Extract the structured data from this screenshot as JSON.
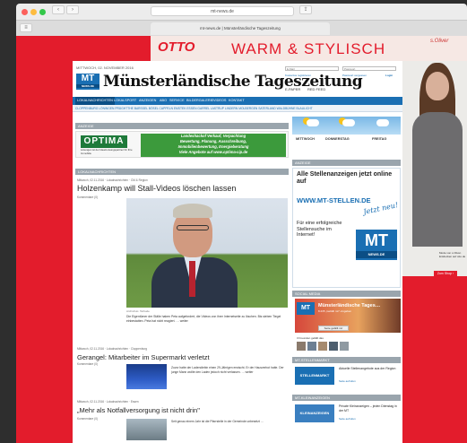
{
  "browser": {
    "url": "mt-news.de",
    "tab_title": "mt-news.de | Münsterländische Tageszeitung"
  },
  "ad_banner": {
    "brand": "OTTO",
    "headline": "WARM & STYLISCH",
    "partner": "s.Oliver"
  },
  "side_ad": {
    "caption": "Mode von s.Oliver. Entdecken auf otto.de",
    "cta": "Zum Shop ›"
  },
  "site": {
    "date": "MITTWOCH, 02. NOVEMBER 2016",
    "logo_top": "MT",
    "logo_bottom": "NEWS.DE",
    "masthead": "Münsterländische Tageszeitung",
    "login": {
      "email_label": "E-Mail",
      "password_label": "Passwort",
      "register": "Kostenlos registrieren",
      "forgot": "Passwort vergessen",
      "submit": "Login"
    },
    "epaper": "E-PAPER",
    "redfeed": "RED FEED",
    "nav_main": [
      "LOKALNACHRICHTEN",
      "LOKALSPORT",
      "ANZEIGEN",
      "ABO",
      "SERVICE",
      "BILDERGALERIE",
      "VIDEOS",
      "KONTAKT"
    ],
    "nav_sub": "CLOPPENBURG  LÖNINGEN  PRÜGHTTHE  BARSSEL  BÖSEL  CAPPELN  EMSTEK  ESSEN  GARREL  LASTRUP  LINDERN  MOLBERGEN  SATERLAND  WALDBÜHNE  BLAULICHT"
  },
  "left": {
    "ad_section": "ANZEIGE",
    "optima": {
      "logo": "OPTIMA",
      "sub": "Lösungen ist der Ideal-Lösungspartner für Ihre Immobilie",
      "lines": [
        "Landeshackof Verkauf, Verpachtung",
        "Bewertung, Planung, Ausschreibung,",
        "Immobilienbewertung, Energieberatung",
        "Viele Angebote auf www.optima-cip.de"
      ]
    },
    "news_section": "LOKALNACHRICHTEN",
    "articles": [
      {
        "meta": "Mittwoch, 02.11.2016 · Lokalnachrichten · CM & Region",
        "title": "Holzenkamp will Stall-Videos löschen lassen",
        "comments": "Kommentare (0)",
        "credit": "Archivfoto: Tarbude",
        "teaser": "Die Eigentümer der Ställe haben Peta aufgefordert, die Videos von ihrer Internetseite zu löschen. Bis sieben Tiegel einbestatten. Peta hat nicht reagiert. … weiter"
      },
      {
        "meta": "Mittwoch, 02.11.2016 · Lokalnachrichten · Cloppenburg",
        "title": "Gerangel: Mitarbeiter im Supermarkt verletzt",
        "comments": "Kommentare (0)",
        "teaser": "Zuvor hatte der Ladendiebin einen 29-Jährigen erwischt. Er der Hausverbot hatte. Der junge Mann wollte den Laden jedoch nicht verlassen. … weiter"
      },
      {
        "meta": "Mittwoch, 02.11.2016 · Lokalnachrichten · Essen",
        "title": "„Mehr als Notfallversorgung ist nicht drin\"",
        "comments": "Kommentare (0)",
        "teaser": "Seit genau einem Jahr ist die Pfarrstelle in der Gemeinde unbesetzt …"
      }
    ]
  },
  "right": {
    "weather_days": [
      "MITTWOCH",
      "DONNERSTAG",
      "FREITAG"
    ],
    "ad_section": "ANZEIGE",
    "jobs": {
      "headline": "Alle Stellenanzeigen jetzt online auf",
      "url": "WWW.MT-STELLEN.DE",
      "jetzt": "Jetzt neu!",
      "sub": "Für eine erfolgreiche Stellensuche im Internet!",
      "logo_top": "MT",
      "logo_bottom": "NEWS.DE"
    },
    "social_section": "SOCIAL MEDIA",
    "social": {
      "page_name": "Münsterländische Tages…",
      "likes": "8.235 „Gefällt mir\"-Angaben",
      "like_button": "Seite gefällt mir",
      "friends": "3 Freunden gefällt das"
    },
    "stellen_section": "MT-STELLENMARKT",
    "stellen": {
      "img": "STELLENMARKT",
      "text": "Aktuelle Stellenangebote aus der Region",
      "link": "Seite aufrufen"
    },
    "klein_section": "MT-KLEINANZEIGEN",
    "klein": {
      "img": "KLEINANZEIGEN",
      "text": "Private Kleinanzeigen – jeden Dienstag in der MT",
      "link": "Seite aufrufen"
    }
  }
}
